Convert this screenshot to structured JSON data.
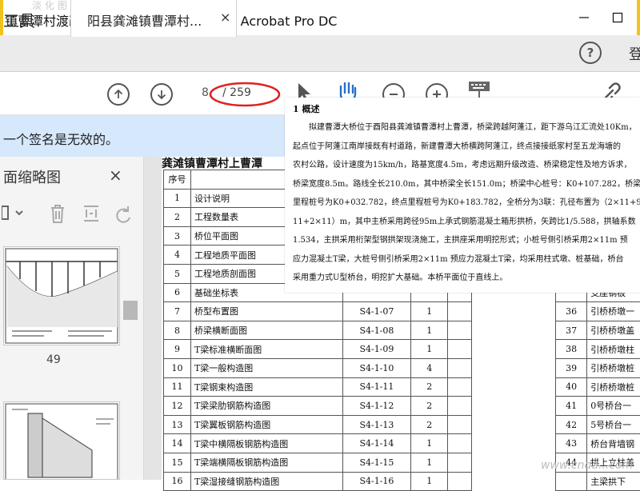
{
  "window": {
    "title": "镇曹潭村渡改桥工程施工图.pdf - Adobe Acrobat Pro DC",
    "watermark_top": "淡化图",
    "minimize_icon": "minimize-icon",
    "maximize_icon": "maximize-icon"
  },
  "tabs": {
    "tools_label": "工具",
    "doc_tab_label": "阳县龚滩镇曹潭村...",
    "close_glyph": "×",
    "help_glyph": "?",
    "signin_label": "登"
  },
  "toolbar": {
    "page_current": "8",
    "page_total": "/ 259",
    "icons": [
      "prev-page-icon",
      "next-page-icon",
      "select-pointer-icon",
      "hand-tool-icon",
      "zoom-out-icon",
      "zoom-in-icon",
      "keyboard-icon",
      "share-link-icon"
    ]
  },
  "banner": {
    "text": "一个签名是无效的。"
  },
  "panel": {
    "title": "面缩略图",
    "close_glyph": "×",
    "thumb_label": "49"
  },
  "doc": {
    "heading": "龚滩镇曹潭村上曹潭",
    "left_rows": [
      {
        "no": "序号",
        "name": "",
        "code": "",
        "qty": ""
      },
      {
        "no": "1",
        "name": "设计说明",
        "code": "",
        "qty": ""
      },
      {
        "no": "2",
        "name": "工程数量表",
        "code": "",
        "qty": ""
      },
      {
        "no": "3",
        "name": "桥位平面图",
        "code": "",
        "qty": ""
      },
      {
        "no": "4",
        "name": "工程地质平面图",
        "code": "",
        "qty": ""
      },
      {
        "no": "5",
        "name": "工程地质剖面图",
        "code": "",
        "qty": ""
      },
      {
        "no": "6",
        "name": "基础坐标表",
        "code": "",
        "qty": ""
      },
      {
        "no": "7",
        "name": "桥型布置图",
        "code": "S4-1-07",
        "qty": "1"
      },
      {
        "no": "8",
        "name": "桥梁横断面图",
        "code": "S4-1-08",
        "qty": "1"
      },
      {
        "no": "9",
        "name": "T梁标准横断面图",
        "code": "S4-1-09",
        "qty": "1"
      },
      {
        "no": "10",
        "name": "T梁一般构造图",
        "code": "S4-1-10",
        "qty": "4"
      },
      {
        "no": "11",
        "name": "T梁钢束构造图",
        "code": "S4-1-11",
        "qty": "2"
      },
      {
        "no": "12",
        "name": "T梁梁肋钢筋构造图",
        "code": "S4-1-12",
        "qty": "2"
      },
      {
        "no": "13",
        "name": "T梁翼板钢筋构造图",
        "code": "S4-1-13",
        "qty": "2"
      },
      {
        "no": "14",
        "name": "T梁中横隔板钢筋构造图",
        "code": "S4-1-14",
        "qty": "1"
      },
      {
        "no": "15",
        "name": "T梁端横隔板钢筋构造图",
        "code": "S4-1-15",
        "qty": "1"
      },
      {
        "no": "16",
        "name": "T梁湿接缝钢筋构造图",
        "code": "S4-1-16",
        "qty": "1"
      }
    ],
    "right_rows": [
      {
        "no": "",
        "name": ""
      },
      {
        "no": "",
        "name": ""
      },
      {
        "no": "",
        "name": ""
      },
      {
        "no": "",
        "name": ""
      },
      {
        "no": "",
        "name": ""
      },
      {
        "no": "",
        "name": ""
      },
      {
        "no": "",
        "name": "支座钢板"
      },
      {
        "no": "36",
        "name": "引桥桥墩一"
      },
      {
        "no": "37",
        "name": "引桥桥墩盖"
      },
      {
        "no": "38",
        "name": "引桥桥墩柱"
      },
      {
        "no": "39",
        "name": "引桥桥墩桩"
      },
      {
        "no": "40",
        "name": "引桥桥墩桩"
      },
      {
        "no": "41",
        "name": "0号桥台一"
      },
      {
        "no": "42",
        "name": "5号桥台一"
      },
      {
        "no": "43",
        "name": "桥台背墙钢"
      },
      {
        "no": "44",
        "name": "拱上立柱盖"
      },
      {
        "no": "",
        "name": "主梁拱下"
      }
    ]
  },
  "popup": {
    "heading": "1 概述",
    "lines": [
      "拟建曹潭大桥位于酉阳县龚滩镇曹潭村上曹潭，桥梁跨越阿蓬江，距下游乌江汇流处10Km，",
      "起点位于阿蓬江南岸接既有村道路，新建曹潭大桥横跨阿蓬江，终点接接纸家村至五龙海塘的",
      "农村公路，设计速度为15km/h，路基宽度4.5m，考虑远期升级改造、桥梁稳定性及地方诉求，",
      "桥梁宽度8.5m。路线全长210.0m，其中桥梁全长151.0m；桥梁中心桩号：K0+107.282，桥梁起点",
      "里程桩号为K0+032.782，终点里程桩号为K0+183.782，全桥分为3联：孔径布置为（2×11+9×",
      "11+2×11）m，其中主桥采用跨径95m上承式钢筋混凝土箱形拱桥，矢跨比1/5.588，拱轴系数",
      "1.534，主拱采用桁架型钢拱架现浇施工，主拱座采用明挖形式；小桩号侧引桥采用2×11m 预",
      "应力混凝土T梁，大桩号侧引桥采用2×11m 预应力混凝土T梁，均采用柱式墩、桩基础，桥台",
      "采用重力式U型桥台，明挖扩大基础。本桥平面位于直线上。"
    ]
  },
  "watermark_bottom": "www.cnda...com"
}
